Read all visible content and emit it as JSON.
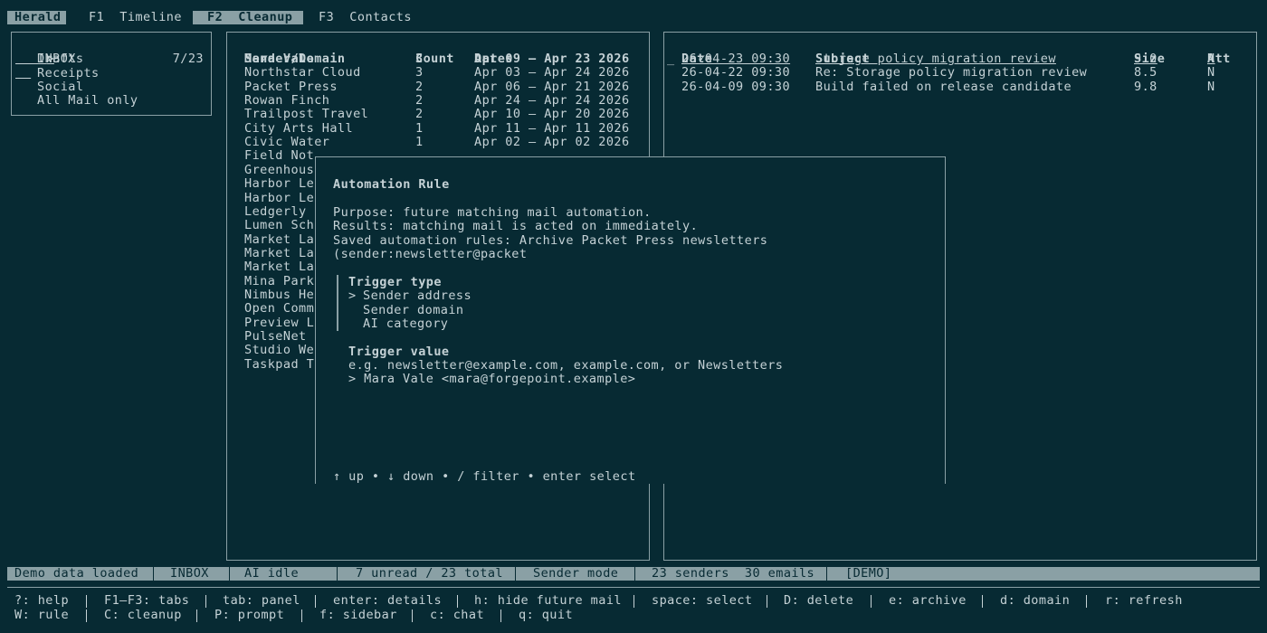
{
  "tabs": {
    "app": "Herald",
    "timeline": "F1  Timeline",
    "cleanup": "F2  Cleanup",
    "contacts": "F3  Contacts"
  },
  "sidebar": {
    "items": [
      {
        "marker": ">",
        "label": "INBOX",
        "count": "7/23"
      },
      {
        "marker": "",
        "label": "Drafts",
        "count": ""
      },
      {
        "marker": "",
        "label": "Receipts",
        "count": ""
      },
      {
        "marker": "",
        "label": "Social",
        "count": ""
      },
      {
        "marker": "",
        "label": "All Mail only",
        "count": ""
      }
    ]
  },
  "senders": {
    "check": "✓",
    "headers": {
      "sender": "Sender/Domain",
      "count": "Count",
      "dates": "Dates"
    },
    "rows": [
      {
        "name": "Mara Vale",
        "count": "3",
        "dates": "Apr 09 – Apr 23 2026"
      },
      {
        "name": "Northstar Cloud",
        "count": "3",
        "dates": "Apr 03 – Apr 24 2026"
      },
      {
        "name": "Packet Press",
        "count": "2",
        "dates": "Apr 06 – Apr 21 2026"
      },
      {
        "name": "Rowan Finch",
        "count": "2",
        "dates": "Apr 24 – Apr 24 2026"
      },
      {
        "name": "Trailpost Travel",
        "count": "2",
        "dates": "Apr 10 – Apr 20 2026"
      },
      {
        "name": "City Arts Hall",
        "count": "1",
        "dates": "Apr 11 – Apr 11 2026"
      },
      {
        "name": "Civic Water",
        "count": "1",
        "dates": "Apr 02 – Apr 02 2026"
      },
      {
        "name": "Field Not",
        "count": "",
        "dates": ""
      },
      {
        "name": "Greenhous",
        "count": "",
        "dates": ""
      },
      {
        "name": "Harbor Le",
        "count": "",
        "dates": ""
      },
      {
        "name": "Harbor Le",
        "count": "",
        "dates": ""
      },
      {
        "name": "Ledgerly",
        "count": "",
        "dates": ""
      },
      {
        "name": "Lumen Sch",
        "count": "",
        "dates": ""
      },
      {
        "name": "Market La",
        "count": "",
        "dates": ""
      },
      {
        "name": "Market La",
        "count": "",
        "dates": ""
      },
      {
        "name": "Market La",
        "count": "",
        "dates": ""
      },
      {
        "name": "Mina Park",
        "count": "",
        "dates": ""
      },
      {
        "name": "Nimbus He",
        "count": "",
        "dates": ""
      },
      {
        "name": "Open Comm",
        "count": "",
        "dates": ""
      },
      {
        "name": "Preview L",
        "count": "",
        "dates": ""
      },
      {
        "name": "PulseNet",
        "count": "",
        "dates": ""
      },
      {
        "name": "Studio We",
        "count": "",
        "dates": ""
      },
      {
        "name": "Taskpad T",
        "count": "",
        "dates": ""
      }
    ]
  },
  "emails": {
    "check": "✓",
    "headers": {
      "date": "Date",
      "subject": "Subject",
      "size": "Size",
      "att": "Att"
    },
    "rows": [
      {
        "marker": "_",
        "date": "26-04-23 09:30",
        "subject": "Storage policy migration review",
        "size": "9.0",
        "att": "N"
      },
      {
        "marker": "",
        "date": "26-04-22 09:30",
        "subject": "Re: Storage policy migration review",
        "size": "8.5",
        "att": "N"
      },
      {
        "marker": "",
        "date": "26-04-09 09:30",
        "subject": "Build failed on release candidate",
        "size": "9.8",
        "att": "N"
      }
    ]
  },
  "modal": {
    "title": "Automation Rule",
    "purpose": "Purpose: future matching mail automation.",
    "results": "Results: matching mail is acted on immediately.",
    "saved": "Saved automation rules: Archive Packet Press newsletters",
    "saved_cont": "(sender:newsletter@packet",
    "trigger_type_label": "Trigger type",
    "trigger_options": [
      {
        "marker": ">",
        "label": "Sender address"
      },
      {
        "marker": "",
        "label": "Sender domain"
      },
      {
        "marker": "",
        "label": "AI category"
      }
    ],
    "trigger_value_label": "Trigger value",
    "trigger_value_hint": "e.g. newsletter@example.com, example.com, or Newsletters",
    "trigger_value_input": "> Mara Vale <mara@forgepoint.example>",
    "footer": "↑ up • ↓ down • / filter • enter select"
  },
  "status": {
    "segments": [
      "Demo data loaded",
      "INBOX",
      "AI idle",
      "7 unread / 23 total",
      "Sender mode",
      "23 senders  30 emails",
      "[DEMO]"
    ]
  },
  "help": {
    "line1": [
      "?: help",
      "F1–F3: tabs",
      "tab: panel",
      "enter: details",
      "h: hide future mail",
      "space: select",
      "D: delete",
      "e: archive",
      "d: domain",
      "r: refresh"
    ],
    "line2": [
      "W: rule",
      "C: cleanup",
      "P: prompt",
      "f: sidebar",
      "c: chat",
      "q: quit"
    ]
  },
  "colors": {
    "background": "#072a33",
    "foreground": "#c5d2d6",
    "accent": "#8aa0a5"
  }
}
